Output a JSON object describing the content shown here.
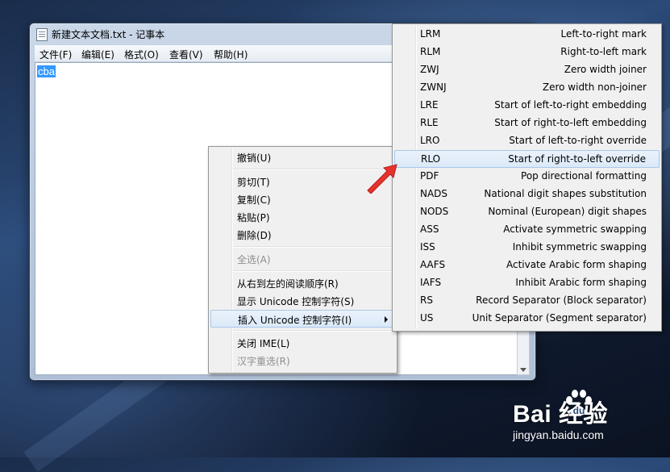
{
  "window": {
    "title": "新建文本文档.txt - 记事本",
    "menus": [
      "文件(F)",
      "编辑(E)",
      "格式(O)",
      "查看(V)",
      "帮助(H)"
    ],
    "content": "cba"
  },
  "context_menu": {
    "items": [
      {
        "label": "撤销(U)",
        "enabled": true
      },
      {
        "label": "剪切(T)",
        "enabled": true
      },
      {
        "label": "复制(C)",
        "enabled": true
      },
      {
        "label": "粘贴(P)",
        "enabled": true
      },
      {
        "label": "删除(D)",
        "enabled": true
      },
      {
        "label": "全选(A)",
        "enabled": false
      },
      {
        "label": "从右到左的阅读顺序(R)",
        "enabled": true
      },
      {
        "label": "显示 Unicode 控制字符(S)",
        "enabled": true
      },
      {
        "label": "插入 Unicode 控制字符(I)",
        "enabled": true,
        "highlighted": true,
        "submenu": true
      },
      {
        "label": "关闭 IME(L)",
        "enabled": true
      },
      {
        "label": "汉字重选(R)",
        "enabled": false
      }
    ]
  },
  "unicode_submenu": {
    "items": [
      {
        "code": "LRM",
        "desc": "Left-to-right mark"
      },
      {
        "code": "RLM",
        "desc": "Right-to-left mark"
      },
      {
        "code": "ZWJ",
        "desc": "Zero width joiner"
      },
      {
        "code": "ZWNJ",
        "desc": "Zero width non-joiner"
      },
      {
        "code": "LRE",
        "desc": "Start of left-to-right embedding"
      },
      {
        "code": "RLE",
        "desc": "Start of right-to-left embedding"
      },
      {
        "code": "LRO",
        "desc": "Start of left-to-right override"
      },
      {
        "code": "RLO",
        "desc": "Start of right-to-left override",
        "highlighted": true
      },
      {
        "code": "PDF",
        "desc": "Pop directional formatting"
      },
      {
        "code": "NADS",
        "desc": "National digit shapes substitution"
      },
      {
        "code": "NODS",
        "desc": "Nominal (European) digit shapes"
      },
      {
        "code": "ASS",
        "desc": "Activate symmetric swapping"
      },
      {
        "code": "ISS",
        "desc": "Inhibit symmetric swapping"
      },
      {
        "code": "AAFS",
        "desc": "Activate Arabic form shaping"
      },
      {
        "code": "IAFS",
        "desc": "Inhibit Arabic form shaping"
      },
      {
        "code": "RS",
        "desc": "Record Separator (Block separator)"
      },
      {
        "code": "US",
        "desc": "Unit Separator (Segment separator)"
      }
    ]
  },
  "watermark": {
    "logo": "Bai  经验",
    "url": "jingyan.baidu.com"
  },
  "colors": {
    "selection": "#3399ff",
    "annotation_arrow": "#e8322e",
    "menu_bg": "#f0f0f0",
    "menu_highlight": "#dbe9f8"
  }
}
